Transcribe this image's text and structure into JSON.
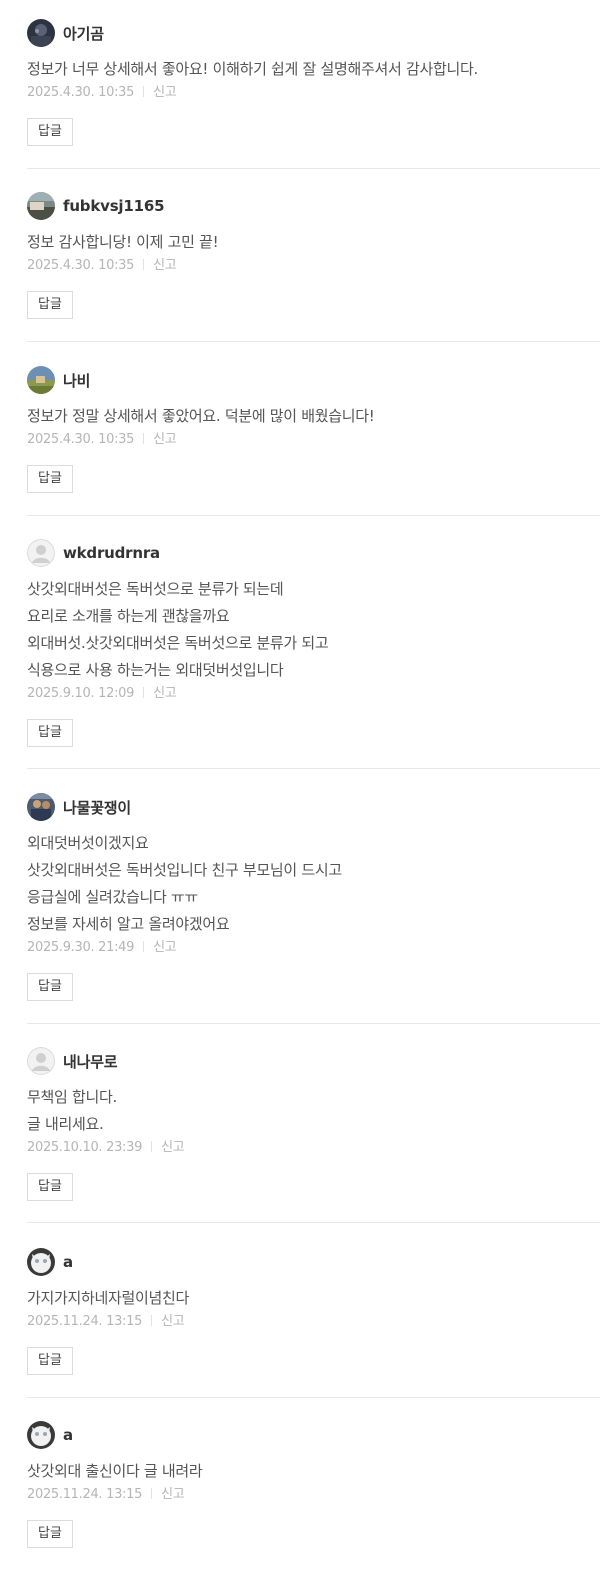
{
  "comments": [
    {
      "author": "아기곰",
      "avatar": "photo-avatar-dark",
      "lines": [
        "정보가 너무 상세해서 좋아요! 이해하기 쉽게 잘 설명해주셔서 감사합니다."
      ],
      "date": "2025.4.30. 10:35",
      "report_label": "신고",
      "reply_label": "답글"
    },
    {
      "author": "fubkvsj1165",
      "avatar": "photo-avatar-landscape",
      "lines": [
        "정보 감사합니당! 이제 고민 끝!"
      ],
      "date": "2025.4.30. 10:35",
      "report_label": "신고",
      "reply_label": "답글"
    },
    {
      "author": "나비",
      "avatar": "photo-avatar-field",
      "lines": [
        "정보가 정말 상세해서 좋았어요. 덕분에 많이 배웠습니다!"
      ],
      "date": "2025.4.30. 10:35",
      "report_label": "신고",
      "reply_label": "답글"
    },
    {
      "author": "wkdrudrnra",
      "avatar": "default-avatar",
      "lines": [
        "삿갓외대버섯은 독버섯으로 분류가 되는데",
        "요리로 소개를 하는게 괜찮을까요",
        "외대버섯.삿갓외대버섯은 독버섯으로 분류가 되고",
        "식용으로 사용 하는거는 외대덧버섯입니다"
      ],
      "date": "2025.9.10. 12:09",
      "report_label": "신고",
      "reply_label": "답글"
    },
    {
      "author": "나물꽃쟁이",
      "avatar": "photo-avatar-people",
      "lines": [
        "외대덧버섯이겠지요",
        "삿갓외대버섯은 독버섯입니다 친구 부모님이 드시고",
        "응급실에 실려갔습니다 ㅠㅠ",
        "정보를 자세히 알고 올려야겠어요"
      ],
      "date": "2025.9.30. 21:49",
      "report_label": "신고",
      "reply_label": "답글"
    },
    {
      "author": "내나무로",
      "avatar": "default-avatar",
      "lines": [
        "무책임 합니다.",
        "글 내리세요."
      ],
      "date": "2025.10.10. 23:39",
      "report_label": "신고",
      "reply_label": "답글"
    },
    {
      "author": "a",
      "avatar": "photo-avatar-cat",
      "lines": [
        "가지가지하네자럴이념친다"
      ],
      "date": "2025.11.24. 13:15",
      "report_label": "신고",
      "reply_label": "답글"
    },
    {
      "author": "a",
      "avatar": "photo-avatar-cat",
      "lines": [
        "삿갓외대 출신이다 글 내려라"
      ],
      "date": "2025.11.24. 13:15",
      "report_label": "신고",
      "reply_label": "답글"
    }
  ]
}
